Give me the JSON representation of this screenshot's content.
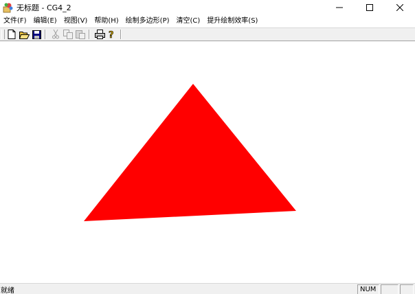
{
  "window": {
    "title": "无标题 - CG4_2",
    "minimize_glyph": "—",
    "maximize_glyph": "☐",
    "close_glyph": "✕"
  },
  "menubar": {
    "items": [
      {
        "label": "文件(F)"
      },
      {
        "label": "编辑(E)"
      },
      {
        "label": "视图(V)"
      },
      {
        "label": "帮助(H)"
      },
      {
        "label": "绘制多边形(P)"
      },
      {
        "label": "清空(C)"
      },
      {
        "label": "提升绘制效率(S)"
      }
    ]
  },
  "toolbar": {
    "buttons": [
      {
        "icon": "new-file-icon",
        "enabled": true
      },
      {
        "icon": "open-folder-icon",
        "enabled": true
      },
      {
        "icon": "save-disk-icon",
        "enabled": true
      },
      {
        "icon": "cut-icon",
        "enabled": false
      },
      {
        "icon": "copy-icon",
        "enabled": false
      },
      {
        "icon": "paste-icon",
        "enabled": false
      },
      {
        "icon": "print-icon",
        "enabled": true
      },
      {
        "icon": "help-icon",
        "enabled": true
      }
    ]
  },
  "canvas": {
    "shape": "triangle",
    "fill_color": "#ff0000"
  },
  "statusbar": {
    "text": "就绪",
    "num_indicator": "NUM",
    "pane2": "",
    "pane3": ""
  },
  "colors": {
    "chrome": "#f0f0f0",
    "canvas": "#ffffff",
    "triangle": "#ff0000"
  }
}
